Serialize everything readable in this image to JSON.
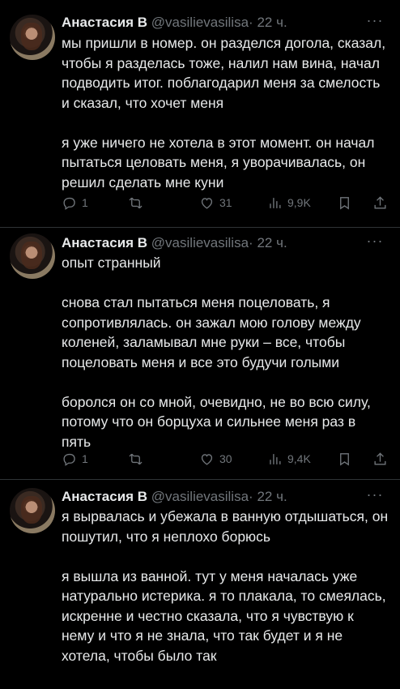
{
  "tweets": [
    {
      "name": "Анастасия В",
      "handle": "@vasilievasilisa",
      "sep": "·",
      "time": "22 ч.",
      "paragraphs": [
        "мы пришли в номер. он разделся догола, сказал, чтобы я разделась тоже, налил нам вина, начал подводить итог. поблагодарил меня за смелость и сказал, что хочет меня",
        "я уже ничего не хотела в этот момент. он начал пытаться целовать меня, я уворачивалась, он решил сделать мне куни"
      ],
      "replies": "1",
      "retweets": "",
      "likes": "31",
      "views": "9,9K"
    },
    {
      "name": "Анастасия В",
      "handle": "@vasilievasilisa",
      "sep": "·",
      "time": "22 ч.",
      "paragraphs": [
        "опыт странный",
        "снова стал пытаться меня поцеловать, я сопротивлялась. он зажал мою голову между коленей, заламывал мне руки – все, чтобы поцеловать меня и все это будучи голыми",
        "боролся он со мной, очевидно, не во всю силу, потому что он борцуха и сильнее меня раз в пять"
      ],
      "replies": "1",
      "retweets": "",
      "likes": "30",
      "views": "9,4K"
    },
    {
      "name": "Анастасия В",
      "handle": "@vasilievasilisa",
      "sep": "·",
      "time": "22 ч.",
      "paragraphs": [
        "я вырвалась и убежала в ванную отдышаться, он пошутил, что я неплохо борюсь",
        "я вышла из ванной. тут у меня началась уже натурально истерика. я то плакала, то смеялась, искренне и честно сказала, что я чувствую к нему и что я не знала, что так будет и я не хотела, чтобы было так"
      ]
    }
  ],
  "colors": {
    "background": "#000000",
    "text": "#e7e9ea",
    "secondary": "#71767b",
    "divider": "#2f3336"
  },
  "icons": {
    "more": "more-dots-icon",
    "reply": "reply-icon",
    "retweet": "retweet-icon",
    "like": "heart-icon",
    "views": "views-bar-icon",
    "bookmark": "bookmark-icon",
    "share": "share-icon"
  }
}
